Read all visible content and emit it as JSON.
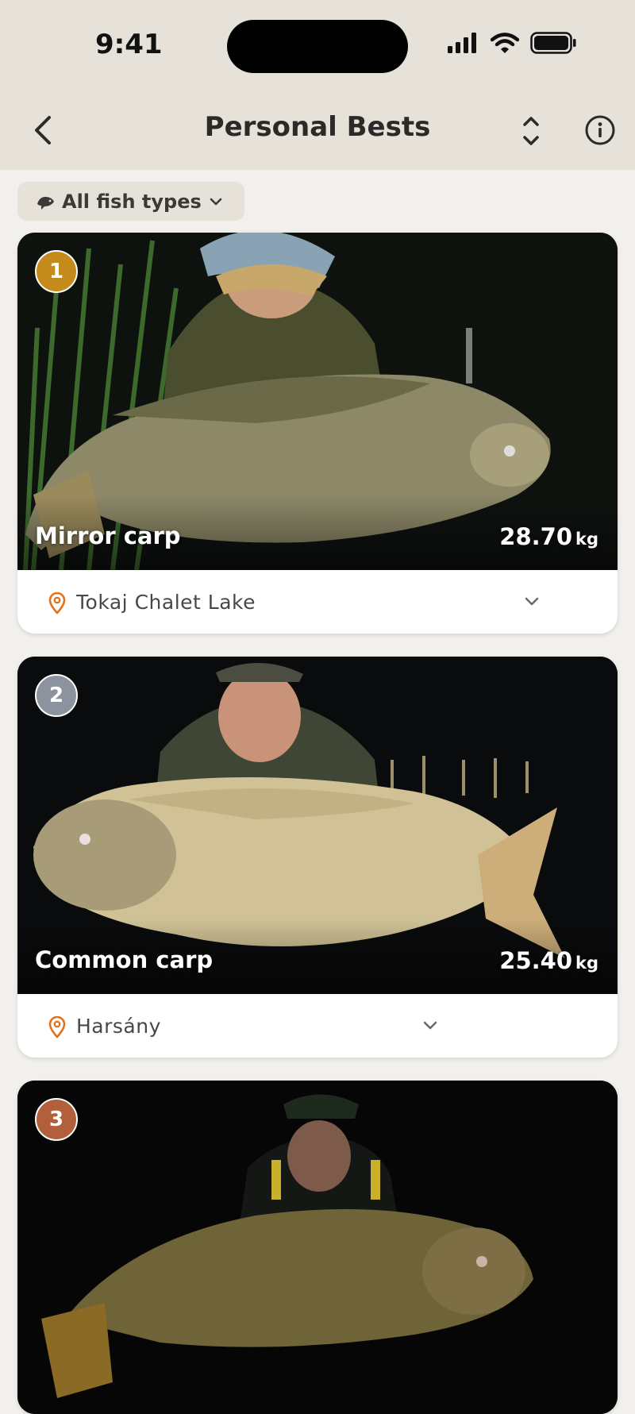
{
  "status": {
    "time": "9:41"
  },
  "nav": {
    "title": "Personal Bests"
  },
  "filter": {
    "label": "All fish types"
  },
  "colors": {
    "gold": "#c48a1c",
    "silver": "#8c939e",
    "bronze": "#b2603c",
    "pin": "#e0721e"
  },
  "catches": [
    {
      "rank": "1",
      "species": "Mirror carp",
      "weight": "28.70",
      "unit": "kg",
      "location": "Tokaj Chalet Lake"
    },
    {
      "rank": "2",
      "species": "Common carp",
      "weight": "25.40",
      "unit": "kg",
      "location": "Harsány"
    },
    {
      "rank": "3"
    }
  ]
}
